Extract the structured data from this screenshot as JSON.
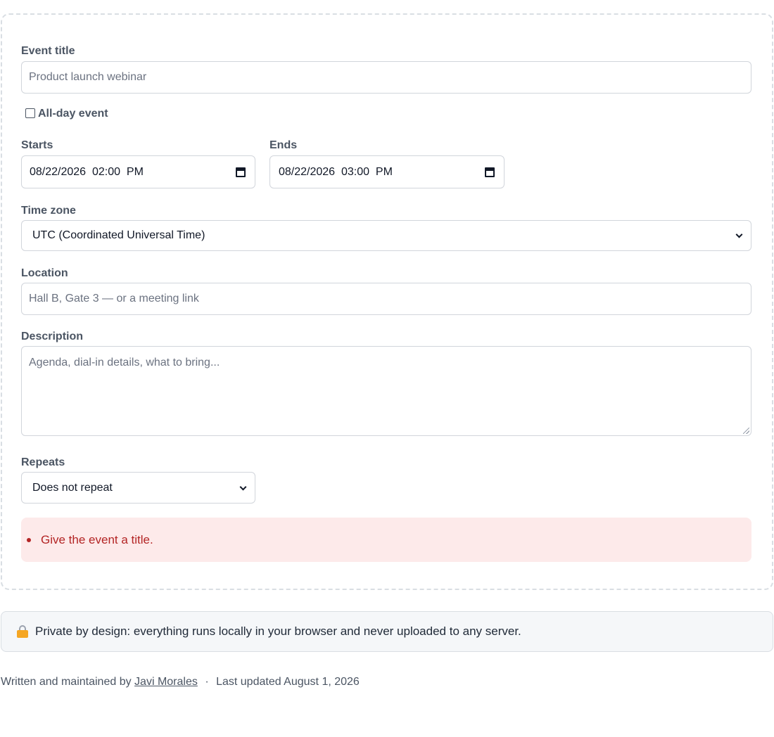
{
  "form": {
    "title_label": "Event title",
    "title_placeholder": "Product launch webinar",
    "all_day_label": "All-day event",
    "starts_label": "Starts",
    "starts_value": "08/22/2026  02:00  PM",
    "ends_label": "Ends",
    "ends_value": "08/22/2026  03:00  PM",
    "timezone_label": "Time zone",
    "timezone_value": "UTC (Coordinated Universal Time)",
    "location_label": "Location",
    "location_placeholder": "Hall B, Gate 3 — or a meeting link",
    "description_label": "Description",
    "description_placeholder": "Agenda, dial-in details, what to bring...",
    "repeats_label": "Repeats",
    "repeats_value": "Does not repeat",
    "error_message": "Give the event a title."
  },
  "privacy": {
    "text": "Private by design: everything runs locally in your browser and never uploaded to any server."
  },
  "footer": {
    "written_by": "Written and maintained by",
    "author": "Javi Morales",
    "separator": "·",
    "last_updated": "Last updated August 1, 2026"
  },
  "colors": {
    "error_bg": "#fdeaea",
    "error_text": "#b32424",
    "privacy_bg": "#f5f7f9"
  }
}
